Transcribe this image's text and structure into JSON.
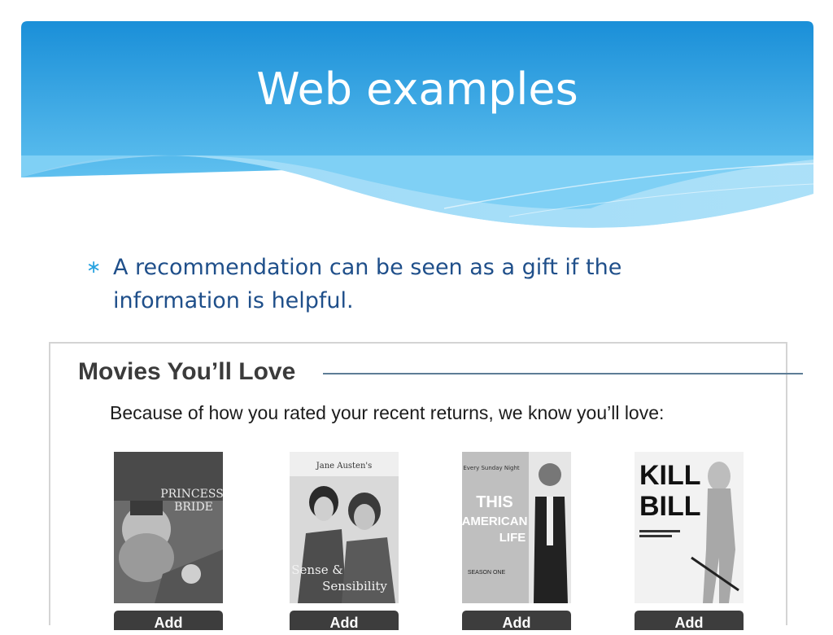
{
  "slide": {
    "title": "Web examples",
    "bullet_marker": "∗",
    "bullet": "A recommendation can be seen as a gift if the information is helpful."
  },
  "figure": {
    "heading": "Movies You’ll Love",
    "subheading": "Because of how you rated your recent returns, we know you’ll love:",
    "add_label": "Add",
    "posters": [
      {
        "name": "princess-bride",
        "lines": [
          "PRINCESS",
          "BRIDE"
        ]
      },
      {
        "name": "sense-and-sensibility",
        "top": "Jane Austen's",
        "lines": [
          "Sense &",
          "Sensibility"
        ]
      },
      {
        "name": "this-american-life",
        "top": "Every Sunday Night",
        "lines": [
          "THIS",
          "AMERICAN",
          "LIFE"
        ],
        "season": "SEASON ONE"
      },
      {
        "name": "kill-bill",
        "lines": [
          "KILL",
          "BILL"
        ]
      }
    ]
  },
  "colors": {
    "header_top": "#1a8fd8",
    "header_bottom": "#66c4f0",
    "bullet_text": "#1f4f8a",
    "bullet_marker": "#2aa3e0"
  }
}
